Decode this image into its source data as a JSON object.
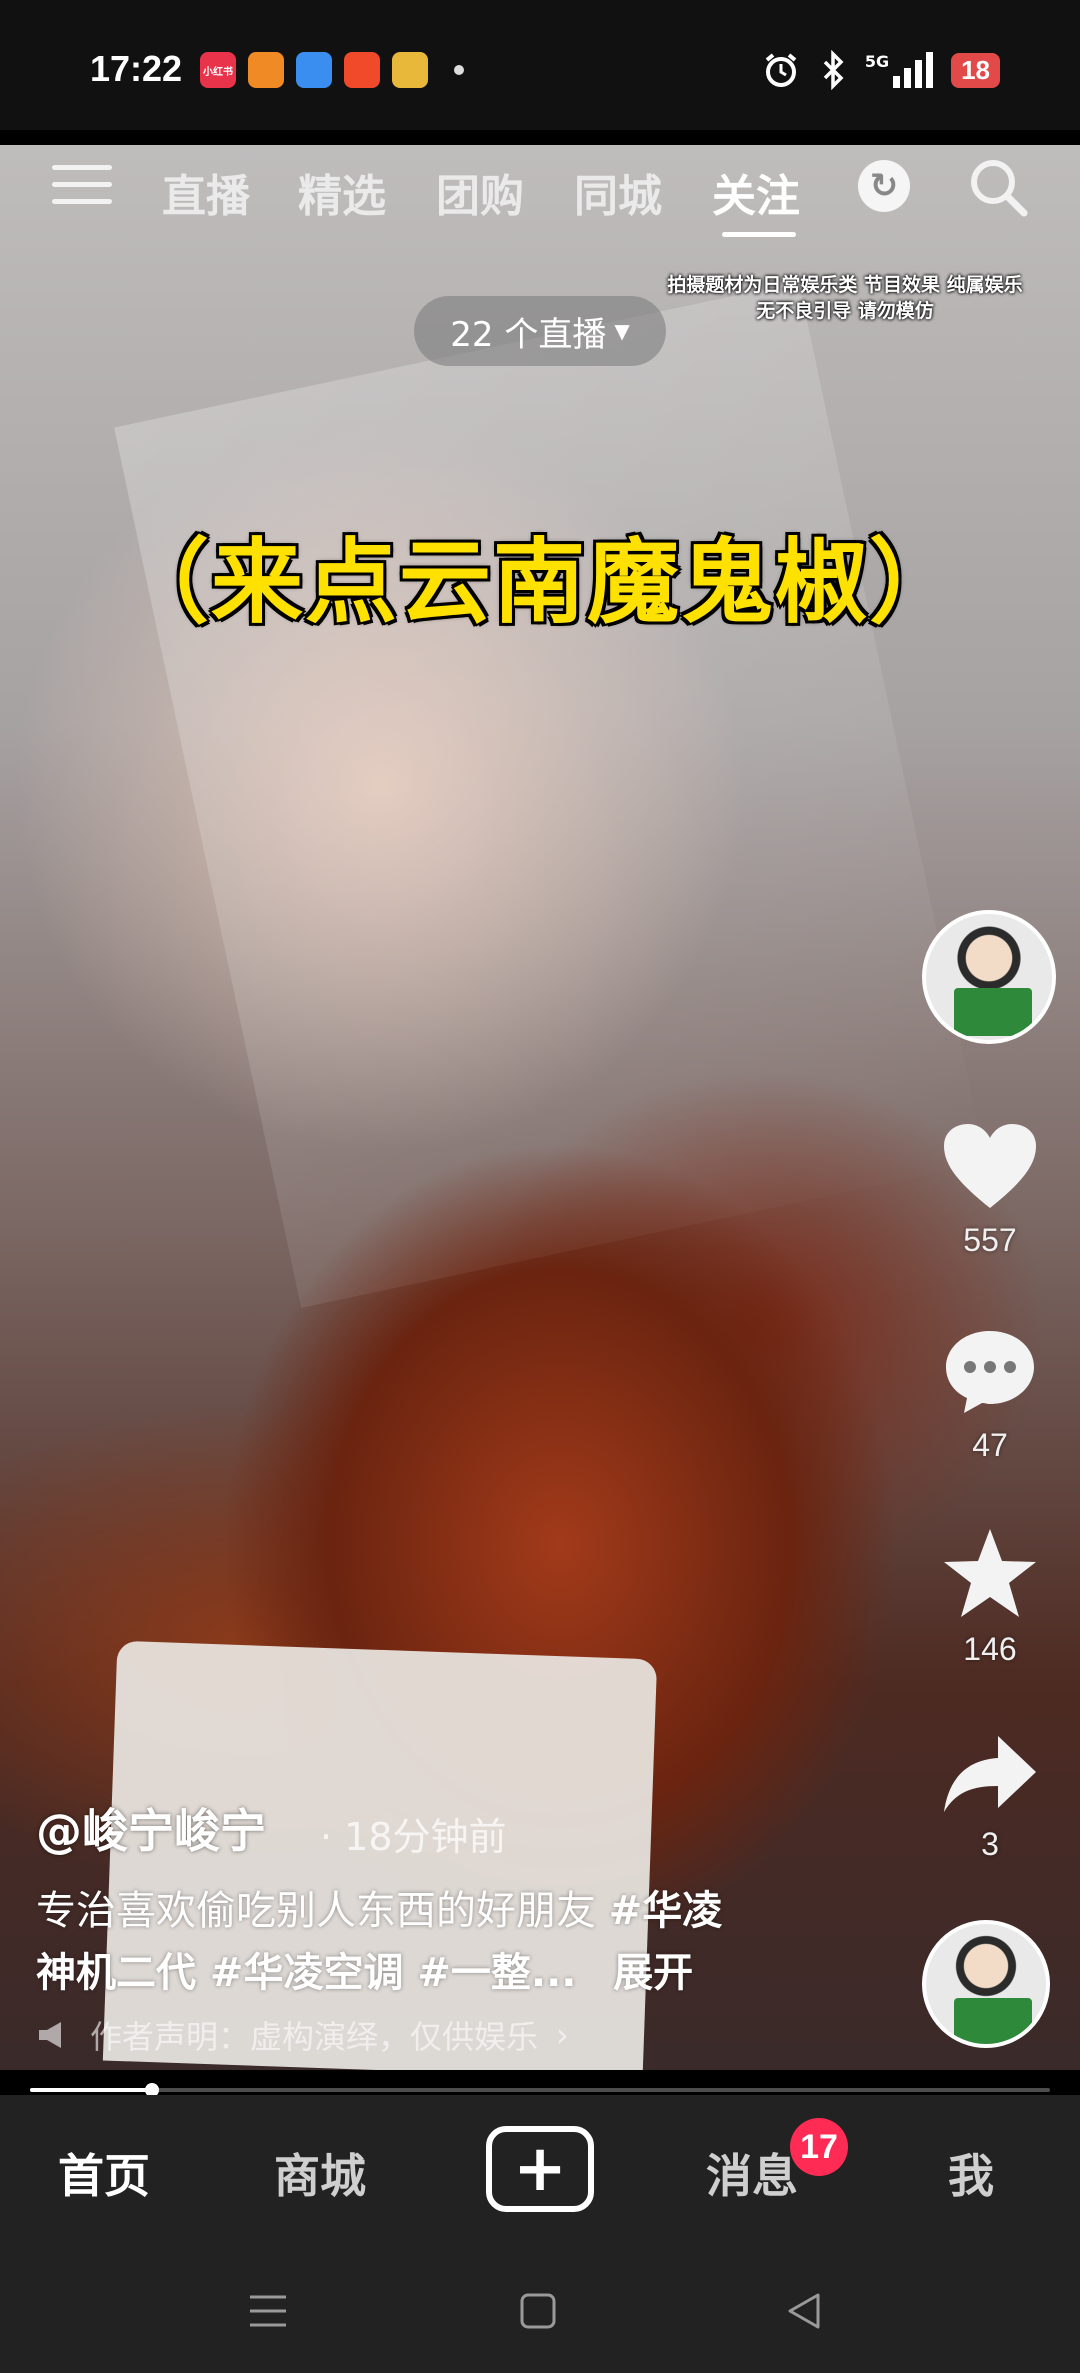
{
  "status_bar": {
    "time": "17:22",
    "apps": [
      {
        "name": "xiaohongshu-app-icon",
        "label": "小红书",
        "color": "#e8334a"
      },
      {
        "name": "orange-app-icon",
        "label": "",
        "color": "#f08a24"
      },
      {
        "name": "blue-app-icon",
        "label": "",
        "color": "#3a8ef0"
      },
      {
        "name": "video-app-icon",
        "label": "",
        "color": "#f04a2a"
      },
      {
        "name": "yellow-app-icon",
        "label": "",
        "color": "#e8b83a"
      }
    ],
    "network": "5G",
    "battery": "18"
  },
  "top_nav": {
    "tabs": [
      "直播",
      "精选",
      "团购",
      "同城",
      "关注"
    ],
    "active_tab": "关注"
  },
  "live_pill": {
    "label": "22 个直播"
  },
  "disclaimer": {
    "line1": "拍摄题材为日常娱乐类 节目效果 纯属娱乐",
    "line2": "无不良引导 请勿模仿"
  },
  "headline": "（来点云南魔鬼椒）",
  "side_rail": {
    "likes": "557",
    "comments": "47",
    "favorites": "146",
    "shares": "3"
  },
  "post": {
    "author": "@峻宁峻宁",
    "time": "· 18分钟前",
    "caption_text": "专治喜欢偷吃别人东西的好朋友 ",
    "tag1": "#华凌",
    "caption_line2_tag": "神机二代 #华凌空调 #一整...",
    "expand": "展开",
    "declaration": "作者声明：虚构演绎，仅供娱乐"
  },
  "progress": {
    "fraction": 0.12
  },
  "bottom_nav": {
    "home": "首页",
    "mall": "商城",
    "messages": "消息",
    "messages_badge": "17",
    "me": "我"
  }
}
